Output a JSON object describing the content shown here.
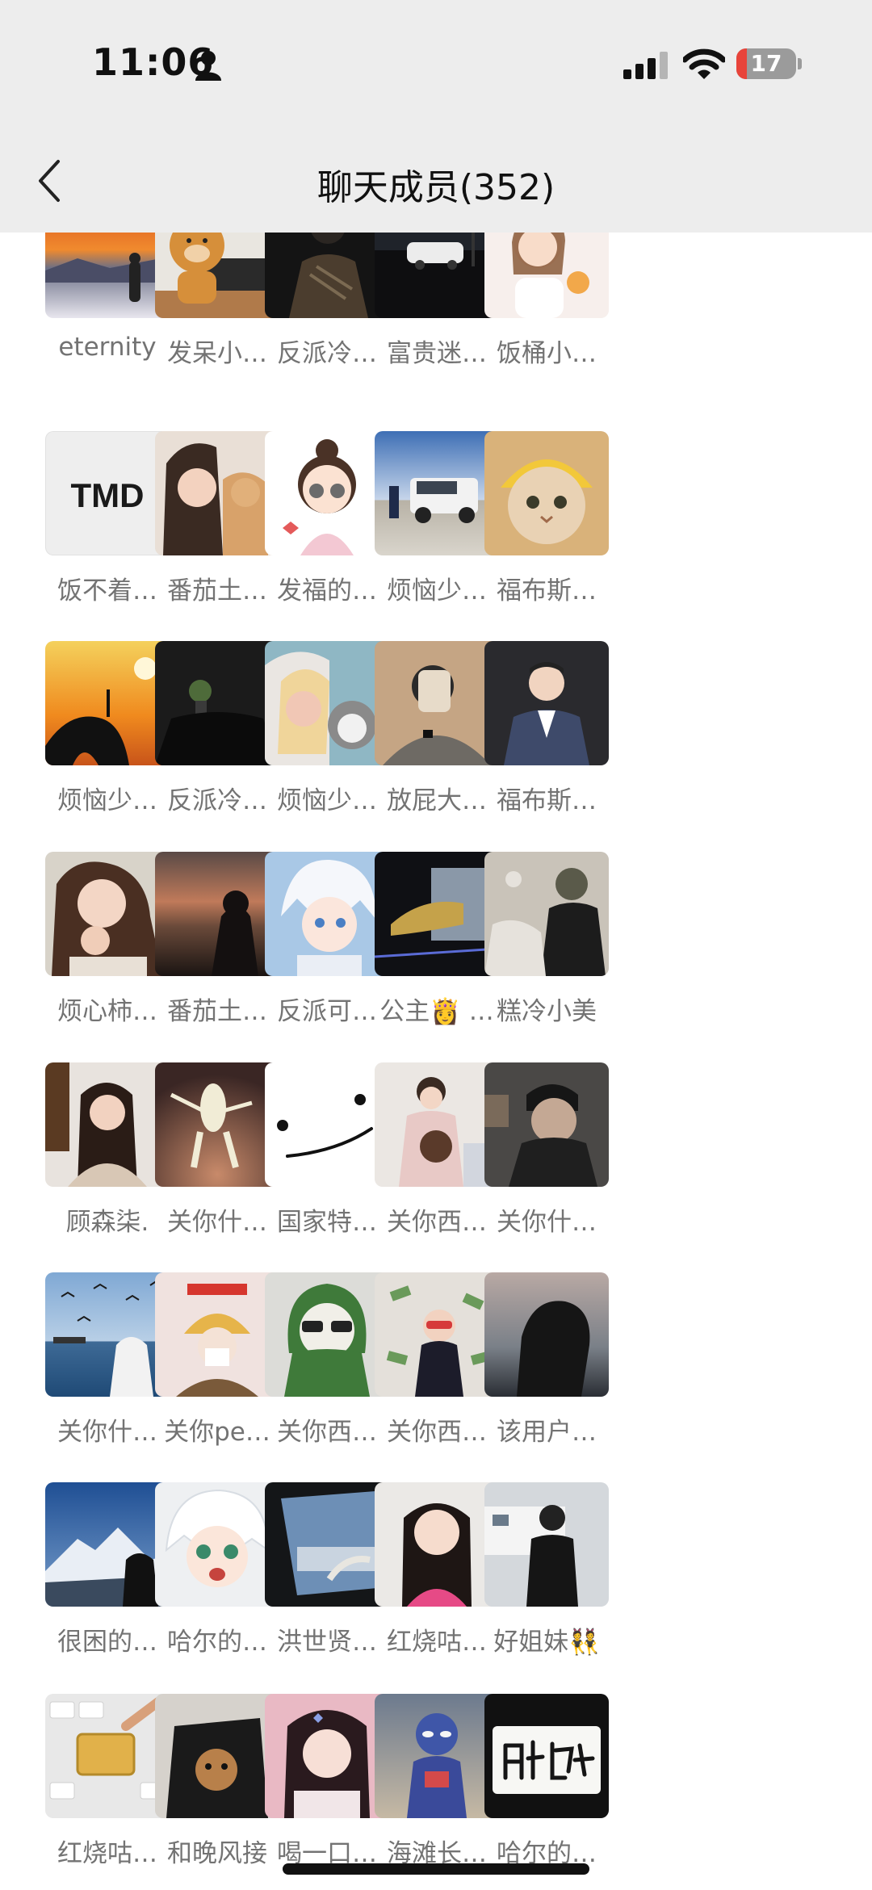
{
  "status_bar": {
    "time": "11:06",
    "battery_level": "17",
    "battery_fraction": 0.17
  },
  "header": {
    "back_icon": "chevron-left-icon",
    "title": "聊天成员(352)"
  },
  "avatar_text": {
    "tmd": "TMD"
  },
  "members": [
    {
      "name": "eternity"
    },
    {
      "name": "发呆小…"
    },
    {
      "name": "反派冷…"
    },
    {
      "name": "富贵迷…"
    },
    {
      "name": "饭桶小…"
    },
    {
      "name": "饭不着…"
    },
    {
      "name": "番茄土…"
    },
    {
      "name": "发福的…"
    },
    {
      "name": "烦恼少…"
    },
    {
      "name": "福布斯…"
    },
    {
      "name": "烦恼少…"
    },
    {
      "name": "反派冷…"
    },
    {
      "name": "烦恼少…"
    },
    {
      "name": "放屁大…"
    },
    {
      "name": "福布斯…"
    },
    {
      "name": "烦心柿…"
    },
    {
      "name": "番茄土…"
    },
    {
      "name": "反派可…"
    },
    {
      "name": "公主👸 …"
    },
    {
      "name": "糕冷小美"
    },
    {
      "name": "顾森柒."
    },
    {
      "name": "关你什…"
    },
    {
      "name": "国家特…"
    },
    {
      "name": "关你西…"
    },
    {
      "name": "关你什…"
    },
    {
      "name": "关你什…"
    },
    {
      "name": "关你pe…"
    },
    {
      "name": "关你西…"
    },
    {
      "name": "关你西…"
    },
    {
      "name": "该用户…"
    },
    {
      "name": "很困的…"
    },
    {
      "name": "哈尔的…"
    },
    {
      "name": "洪世贤…"
    },
    {
      "name": "红烧咕…"
    },
    {
      "name": "好姐妹👯"
    },
    {
      "name": "红烧咕…"
    },
    {
      "name": "和晚风接"
    },
    {
      "name": "喝一口…"
    },
    {
      "name": "海滩长…"
    },
    {
      "name": "哈尔的…"
    }
  ]
}
